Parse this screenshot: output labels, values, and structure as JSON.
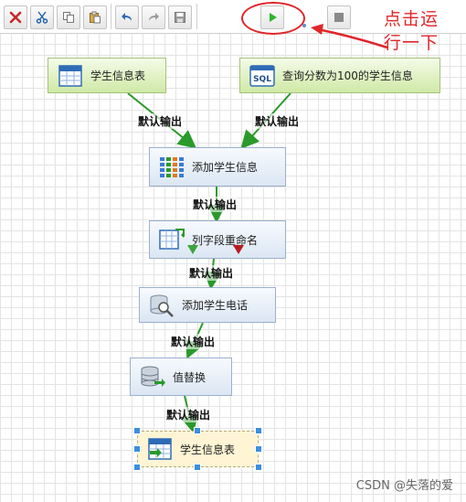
{
  "annotation": {
    "line1": "点击运",
    "line2": "行一下"
  },
  "nodes": {
    "student_table": "学生信息表",
    "sql_query": "查询分数为100的学生信息",
    "add_info": "添加学生信息",
    "rename_fields": "列字段重命名",
    "add_phone": "添加学生电话",
    "replace_value": "值替换",
    "output_table": "学生信息表"
  },
  "edge_label": "默认输出",
  "sql_icon_text": "SQL",
  "watermark": "CSDN @失落的爱",
  "colors": {
    "wire": "#2a9a2a",
    "annotation": "#e0262a",
    "run": "#2bb52b",
    "handle": "#3b8fe0"
  },
  "icons": [
    "delete-icon",
    "cut-icon",
    "copy-icon",
    "paste-icon",
    "undo-icon",
    "redo-icon",
    "save-icon",
    "run-icon",
    "step-icon",
    "stop-icon"
  ]
}
